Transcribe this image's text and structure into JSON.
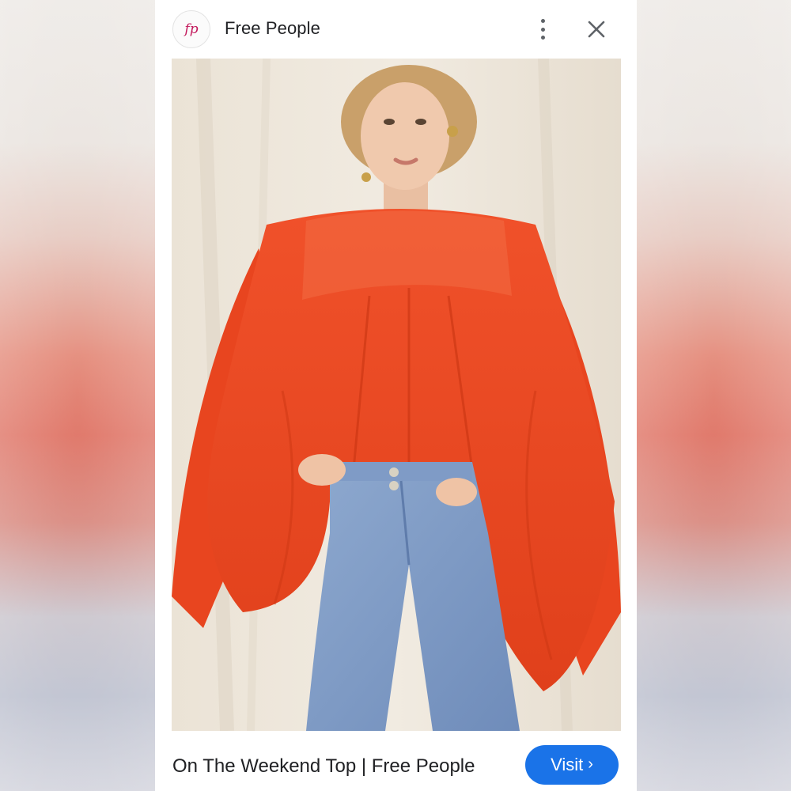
{
  "header": {
    "logo_text": "fp",
    "site_name": "Free People",
    "more_icon": "more-vert-icon",
    "close_icon": "close-icon"
  },
  "image": {
    "subject": "model-in-red-top-and-jeans"
  },
  "footer": {
    "product_title": "On The Weekend Top | Free People",
    "visit_label": "Visit",
    "visit_icon": "chevron-right-icon"
  },
  "colors": {
    "accent": "#1a73e8",
    "logo": "#c2185b",
    "top": "#e8401c",
    "jeans": "#7d9ac4",
    "backdrop": "#ede6da"
  }
}
